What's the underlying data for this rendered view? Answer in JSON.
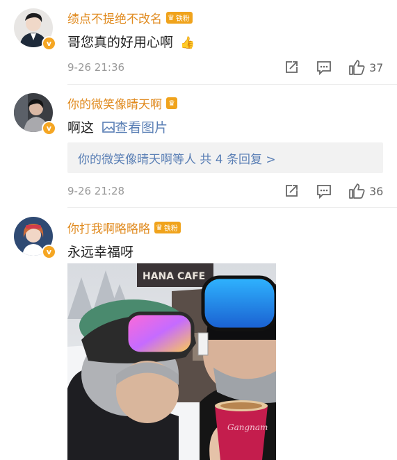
{
  "comments": [
    {
      "username": "绩点不提绝不改名",
      "badge": "铁粉",
      "text": "哥您真的好用心啊",
      "emoji": "👍",
      "time": "9-26 21:36",
      "likes": "37"
    },
    {
      "username": "你的微笑像晴天啊",
      "text": "啊这",
      "image_link": "查看图片",
      "replies": "你的微笑像晴天啊等人 共 4 条回复 >",
      "time": "9-26 21:28",
      "likes": "36"
    },
    {
      "username": "你打我啊略略略",
      "badge": "铁粉",
      "text": "永远幸福呀",
      "photo_sign": "HANA CAFE",
      "cup_text": "Gangnam"
    }
  ],
  "icons": {
    "repost": "repost-icon",
    "comment": "comment-icon",
    "like": "thumb-up-icon",
    "verified": "v-badge-icon",
    "image": "image-icon"
  },
  "colors": {
    "username": "#e08a1e",
    "link": "#5a7fb5",
    "meta": "#999999",
    "badge": "#f0a31c"
  }
}
